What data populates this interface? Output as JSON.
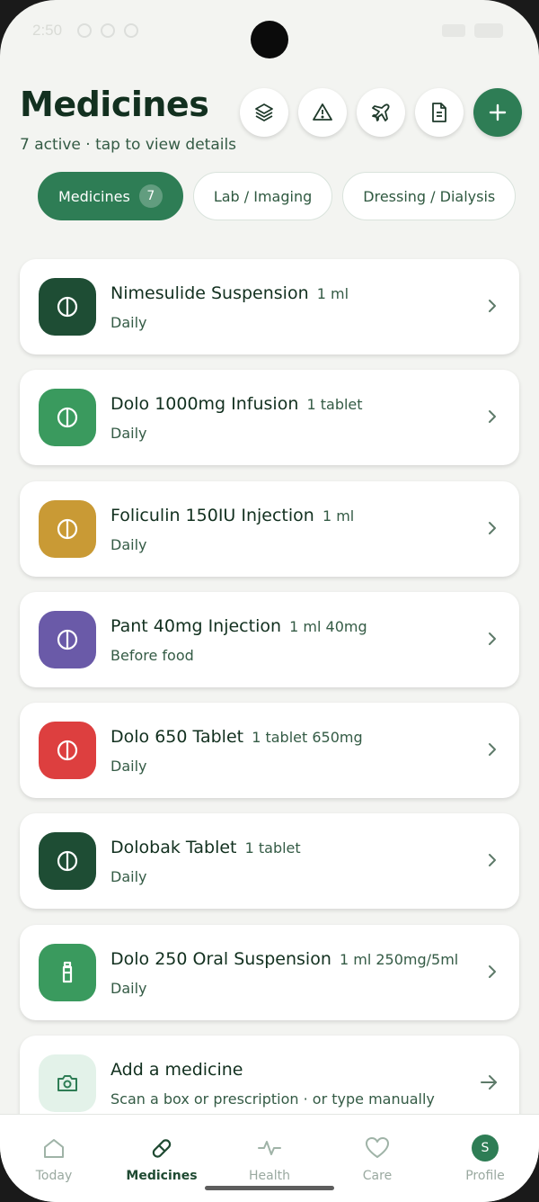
{
  "status": {
    "time": "2:50"
  },
  "header": {
    "title": "Medicines",
    "subtitle": "7 active · tap to view details"
  },
  "header_actions": [
    {
      "icon": "layers-icon"
    },
    {
      "icon": "warning-icon"
    },
    {
      "icon": "plane-icon"
    },
    {
      "icon": "document-icon"
    },
    {
      "icon": "plus-icon"
    }
  ],
  "tabs": [
    {
      "label": "Medicines",
      "count": "7",
      "active": true
    },
    {
      "label": "Lab / Imaging",
      "active": false
    },
    {
      "label": "Dressing / Dialysis",
      "active": false
    }
  ],
  "medicines": [
    {
      "name": "Nimesulide Suspension",
      "dose": "1 ml",
      "schedule": "Daily",
      "color": "#1e4d34",
      "icon": "pill-icon"
    },
    {
      "name": "Dolo 1000mg Infusion",
      "dose": "1 tablet",
      "schedule": "Daily",
      "color": "#3a9a5e",
      "icon": "pill-icon"
    },
    {
      "name": "Foliculin 150IU Injection",
      "dose": "1 ml",
      "schedule": "Daily",
      "color": "#c99a35",
      "icon": "pill-icon"
    },
    {
      "name": "Pant 40mg Injection",
      "dose": "1 ml 40mg",
      "schedule": "Before food",
      "color": "#6a5aa8",
      "icon": "pill-icon"
    },
    {
      "name": "Dolo 650 Tablet",
      "dose": "1 tablet 650mg",
      "schedule": "Daily",
      "color": "#dd3f3f",
      "icon": "pill-icon"
    },
    {
      "name": "Dolobak Tablet",
      "dose": "1 tablet",
      "schedule": "Daily",
      "color": "#1e4d34",
      "icon": "pill-icon"
    },
    {
      "name": "Dolo 250 Oral Suspension",
      "dose": "1 ml 250mg/5ml",
      "schedule": "Daily",
      "color": "#3a9a5e",
      "icon": "bottle-icon"
    }
  ],
  "add_medicine": {
    "title": "Add a medicine",
    "subtitle": "Scan a box or prescription · or type manually"
  },
  "nav": [
    {
      "label": "Today",
      "icon": "home-icon",
      "active": false
    },
    {
      "label": "Medicines",
      "icon": "pill-nav-icon",
      "active": true
    },
    {
      "label": "Health",
      "icon": "pulse-icon",
      "active": false
    },
    {
      "label": "Care",
      "icon": "heart-icon",
      "active": false
    },
    {
      "label": "Profile",
      "icon": "avatar",
      "avatar_letter": "S",
      "active": false
    }
  ],
  "colors": {
    "primary": "#2e7d55",
    "text_dark": "#12301f",
    "text_muted": "#345b45"
  }
}
